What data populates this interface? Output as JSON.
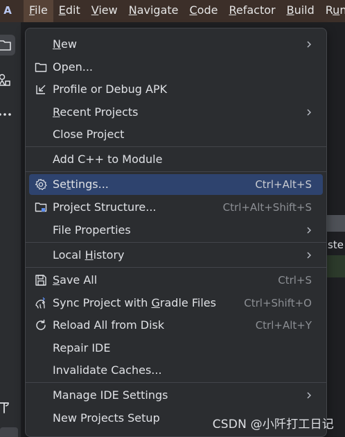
{
  "app": {
    "logo_glyph": "A"
  },
  "menubar": {
    "items": [
      {
        "pre": "",
        "mn": "F",
        "post": "ile"
      },
      {
        "pre": "",
        "mn": "E",
        "post": "dit"
      },
      {
        "pre": "",
        "mn": "V",
        "post": "iew"
      },
      {
        "pre": "",
        "mn": "N",
        "post": "avigate"
      },
      {
        "pre": "",
        "mn": "C",
        "post": "ode"
      },
      {
        "pre": "",
        "mn": "R",
        "post": "efactor"
      },
      {
        "pre": "",
        "mn": "B",
        "post": "uild"
      },
      {
        "pre": "R",
        "mn": "u",
        "post": "n"
      }
    ]
  },
  "editor": {
    "peek_text": "ste"
  },
  "file_menu": {
    "new": {
      "pre": "",
      "mn": "N",
      "post": "ew"
    },
    "open": {
      "label": "Open..."
    },
    "profile_debug_apk": {
      "label": "Profile or Debug APK"
    },
    "recent_projects": {
      "pre": "",
      "mn": "R",
      "post": "ecent Projects"
    },
    "close_project": {
      "label": "Close Project"
    },
    "add_cpp": {
      "label": "Add C++ to Module"
    },
    "settings": {
      "pre": "Se",
      "mn": "t",
      "post": "tings...",
      "shortcut": "Ctrl+Alt+S"
    },
    "project_structure": {
      "label": "Project Structure...",
      "shortcut": "Ctrl+Alt+Shift+S"
    },
    "file_properties": {
      "label": "File Properties"
    },
    "local_history": {
      "pre": "Local ",
      "mn": "H",
      "post": "istory"
    },
    "save_all": {
      "pre": "",
      "mn": "S",
      "post": "ave All",
      "shortcut": "Ctrl+S"
    },
    "sync_gradle": {
      "pre": "Sync Project with ",
      "mn": "G",
      "post": "radle Files",
      "shortcut": "Ctrl+Shift+O"
    },
    "reload_disk": {
      "label": "Reload All from Disk",
      "shortcut": "Ctrl+Alt+Y"
    },
    "repair_ide": {
      "label": "Repair IDE"
    },
    "invalidate_caches": {
      "label": "Invalidate Caches..."
    },
    "manage_ide_settings": {
      "label": "Manage IDE Settings"
    },
    "new_projects_setup": {
      "label": "New Projects Setup"
    }
  },
  "watermark": {
    "text": "CSDN @小阡打工日记"
  },
  "colors": {
    "menubar_bg": "#3c2f29",
    "menu_bg": "#2b2d30",
    "selection_bg": "#2e436e",
    "text": "#dfe1e5",
    "shortcut_text": "#8c8f94"
  }
}
